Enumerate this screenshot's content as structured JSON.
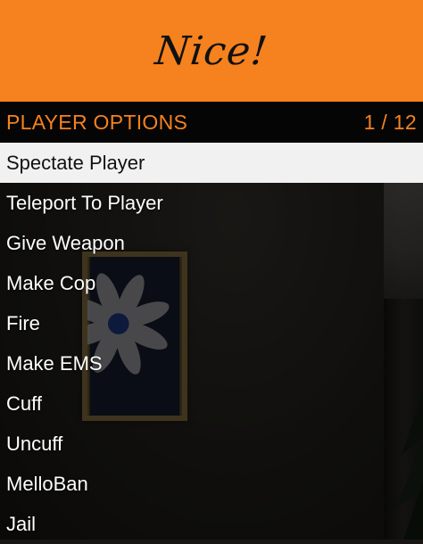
{
  "banner": {
    "title": "Nice!",
    "color": "#f5821f"
  },
  "submenu": {
    "title": "PLAYER OPTIONS",
    "counter": "1 / 12",
    "color": "#f5821f"
  },
  "items": [
    {
      "label": "Spectate Player",
      "selected": true
    },
    {
      "label": "Teleport To Player",
      "selected": false
    },
    {
      "label": "Give Weapon",
      "selected": false
    },
    {
      "label": "Make Cop",
      "selected": false
    },
    {
      "label": "Fire",
      "selected": false
    },
    {
      "label": "Make EMS",
      "selected": false
    },
    {
      "label": "Cuff",
      "selected": false
    },
    {
      "label": "Uncuff",
      "selected": false
    },
    {
      "label": "MelloBan",
      "selected": false
    },
    {
      "label": "Jail",
      "selected": false
    }
  ],
  "colors": {
    "accent": "#f5821f",
    "subheader_bg": "#050505",
    "selected_bg": "#f1f1f1",
    "item_text": "#ffffff"
  }
}
